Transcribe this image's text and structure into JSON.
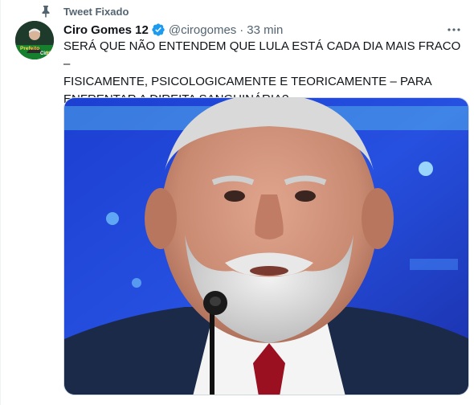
{
  "pinned": {
    "label": "Tweet Fixado",
    "icon": "pin-icon"
  },
  "author": {
    "display_name": "Ciro Gomes 12",
    "handle": "@cirogomes",
    "verified_icon": "verified-badge-icon",
    "verified_color": "#1d9bf0",
    "avatar_texts": [
      "Prefeito",
      "Ciro",
      "12"
    ]
  },
  "timestamp": "33 min",
  "separator": "·",
  "more_icon": "more-options-icon",
  "text": "SERÁ QUE NÃO ENTENDEM QUE LULA ESTÁ CADA DIA MAIS FRACO –\nFISICAMENTE, PSICOLOGICAMENTE E TEORICAMENTE – PARA\nENFRENTAR A DIREITA SANGUINÁRIA?",
  "media": {
    "type": "photo"
  }
}
